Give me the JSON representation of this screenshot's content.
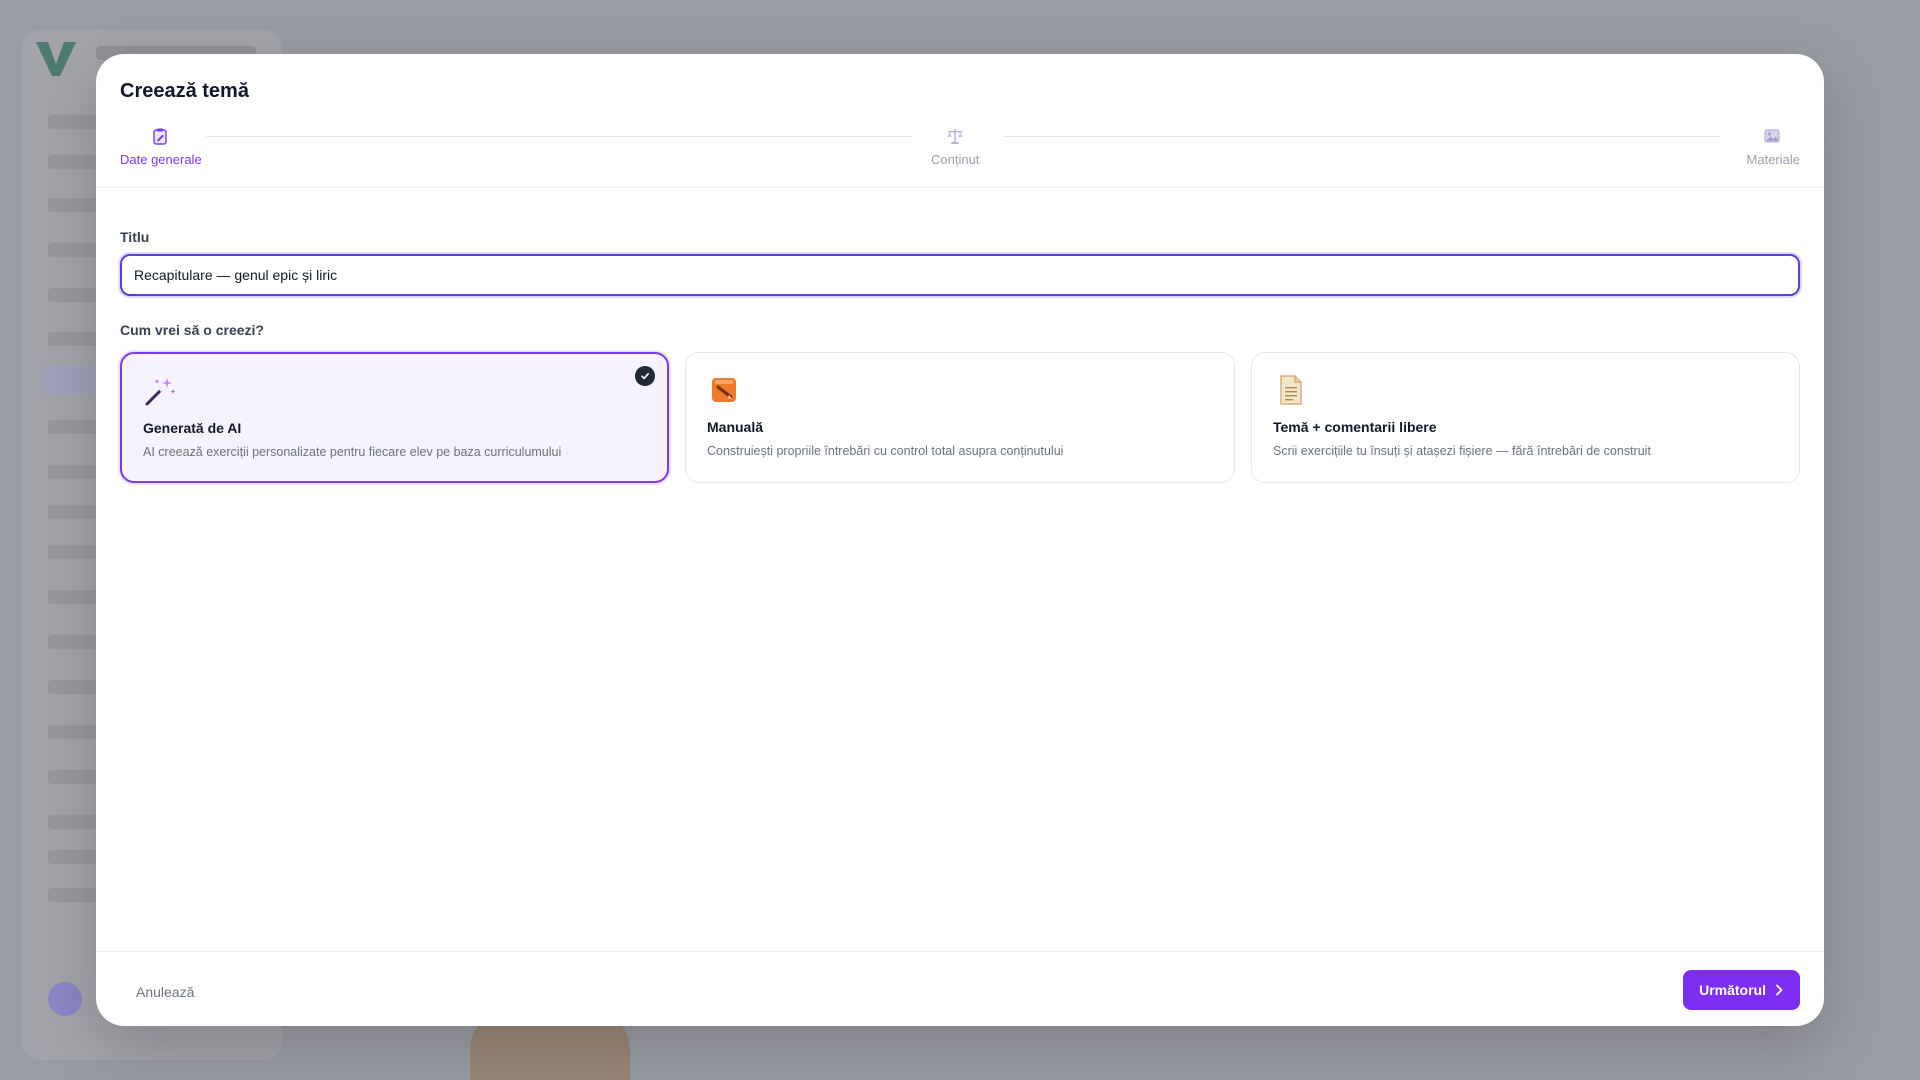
{
  "modal": {
    "title": "Creează temă"
  },
  "stepper": {
    "steps": [
      {
        "label": "Date generale",
        "icon": "clipboard-edit-icon",
        "state": "active"
      },
      {
        "label": "Conținut",
        "icon": "balance-scale-icon",
        "state": "inactive"
      },
      {
        "label": "Materiale",
        "icon": "image-icon",
        "state": "inactive"
      }
    ]
  },
  "form": {
    "title_label": "Titlu",
    "title_value": "Recapitulare — genul epic și liric",
    "method_label": "Cum vrei să o creezi?",
    "options": [
      {
        "title": "Generată de AI",
        "description": "AI creează exerciții personalizate pentru fiecare elev pe baza curriculumului",
        "icon": "magic-wand-icon",
        "selected": true
      },
      {
        "title": "Manuală",
        "description": "Construiești propriile întrebări cu control total asupra conținutului",
        "icon": "notebook-pencil-icon",
        "selected": false
      },
      {
        "title": "Temă + comentarii libere",
        "description": "Scrii exercițiile tu însuți și atașezi fișiere — fără întrebări de construit",
        "icon": "document-icon",
        "selected": false
      }
    ]
  },
  "footer": {
    "cancel_label": "Anulează",
    "next_label": "Următorul"
  },
  "colors": {
    "accent": "#7c3aed",
    "primary_button": "#7c2ff0",
    "input_focus": "#5b3fd6"
  }
}
